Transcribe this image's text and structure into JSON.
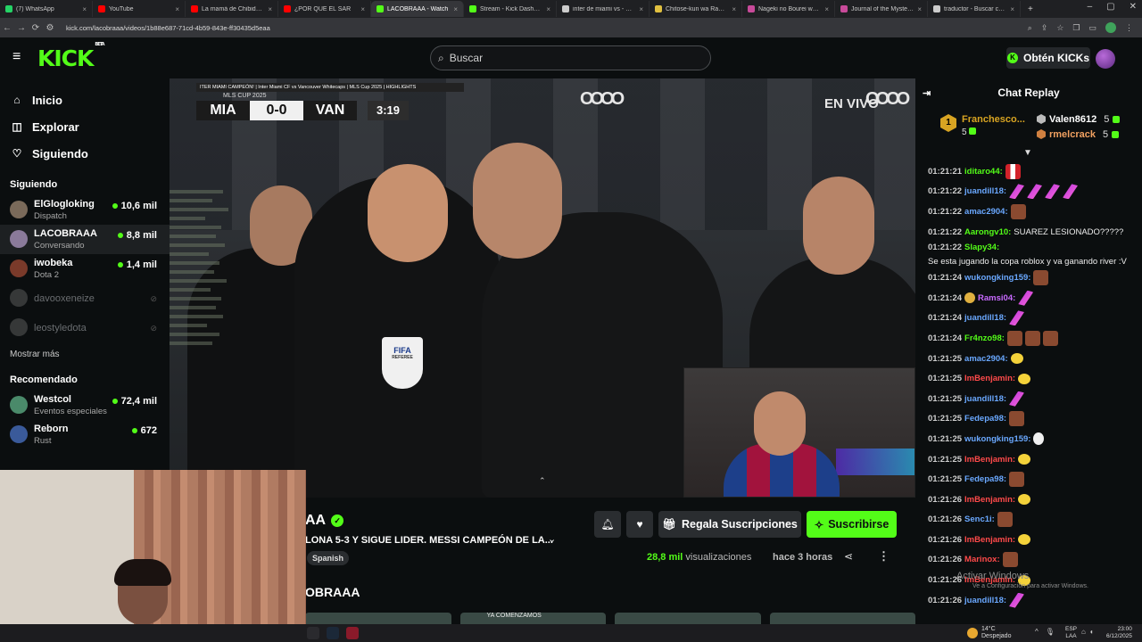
{
  "browser": {
    "tabs": [
      {
        "label": "(7) WhatsApp",
        "color": "#25d366",
        "active": false
      },
      {
        "label": "YouTube",
        "color": "#ff0000",
        "active": false
      },
      {
        "label": "La mamá de Chibidoki ap",
        "color": "#ff0000",
        "active": false
      },
      {
        "label": "¿POR QUÉ EL SAR",
        "color": "#ff0000",
        "active": false
      },
      {
        "label": "LACOBRAAA - Watch",
        "color": "#53fc18",
        "active": true
      },
      {
        "label": "Stream - Kick Dashboard",
        "color": "#53fc18",
        "active": false
      },
      {
        "label": "inter de miami vs - Busca",
        "color": "#cccccc",
        "active": false
      },
      {
        "label": "Chitose-kun wa Ramune",
        "color": "#e0c040",
        "active": false
      },
      {
        "label": "Nageki no Bourei wa In",
        "color": "#c84a9a",
        "active": false
      },
      {
        "label": "Journal of the Mysterio",
        "color": "#c84a9a",
        "active": false
      },
      {
        "label": "traductor - Buscar con G",
        "color": "#cccccc",
        "active": false
      }
    ],
    "url": "kick.com/lacobraaa/videos/1b88e687-71cd-4b59-843e-ff30435d5eaa"
  },
  "header": {
    "logo": "KICK",
    "logo_sup": "BETA",
    "search_placeholder": "Buscar",
    "kicks_button": "Obtén KICKs"
  },
  "sidebar": {
    "nav": [
      {
        "label": "Inicio",
        "icon": "home-icon"
      },
      {
        "label": "Explorar",
        "icon": "compass-icon"
      },
      {
        "label": "Siguiendo",
        "icon": "heart-icon"
      }
    ],
    "following_title": "Siguiendo",
    "following": [
      {
        "name": "ElGlogloking",
        "category": "Dispatch",
        "viewers": "10,6 mil",
        "color": "#7a6a5a"
      },
      {
        "name": "LACOBRAAA",
        "category": "Conversando",
        "viewers": "8,8 mil",
        "color": "#8a7a9a"
      },
      {
        "name": "iwobeka",
        "category": "Dota 2",
        "viewers": "1,4 mil",
        "color": "#7a3a2a"
      },
      {
        "name": "davooxeneize",
        "category": "",
        "viewers": "",
        "color": "#888888"
      },
      {
        "name": "leostyledota",
        "category": "",
        "viewers": "",
        "color": "#888888"
      }
    ],
    "show_more": "Mostrar más",
    "recommended_title": "Recomendado",
    "recommended": [
      {
        "name": "Westcol",
        "category": "Eventos especiales",
        "viewers": "72,4 mil",
        "color": "#4a8a6a"
      },
      {
        "name": "Reborn",
        "category": "Rust",
        "viewers": "672",
        "color": "#3a5a9a"
      }
    ]
  },
  "player": {
    "scorebug_top": "ITER MIAMI CAMPEÓN! | Inter Miami CF vs Vancouver Whitecaps | MLS Cup 2025 | HIGHLIGHTS",
    "scorebug_sub": "MLS CUP 2025",
    "home": "MIA",
    "score": "0-0",
    "away": "VAN",
    "clock": "3:19",
    "live": "EN VIVO",
    "audi": "OOOO",
    "fifa": "FIFA",
    "referee": "REFEREE"
  },
  "stream": {
    "channel": "AA",
    "title": "LONA 5-3 Y SIGUE LIDER. MESSI CAMPEÓN DE LA...",
    "language": "Spanish",
    "gift_button": "Regala Suscripciones",
    "subscribe_button": "Suscribirse",
    "views_count": "28,8 mil",
    "views_label": "visualizaciones",
    "since": "hace 3 horas",
    "section_title": "OBRAAA",
    "thumbs": [
      "",
      "YA COMENZAMOS",
      "",
      ""
    ]
  },
  "chat": {
    "title": "Chat Replay",
    "top_gifter": {
      "rank": "1",
      "name": "Franchesco...",
      "count": "5"
    },
    "gifters": [
      {
        "name": "Valen8612",
        "count": "5",
        "color": "#ffffff"
      },
      {
        "name": "rmelcrack",
        "count": "5",
        "color": "#f0a060"
      }
    ],
    "messages": [
      {
        "time": "01:21:21",
        "user": "iditaro44:",
        "color": "#53fc18",
        "text": "",
        "emotes": [
          "flag"
        ]
      },
      {
        "time": "01:21:22",
        "user": "juandill18:",
        "color": "#6aa8ff",
        "text": "",
        "emotes": [
          "purple",
          "purple",
          "purple",
          "purple"
        ]
      },
      {
        "time": "01:21:22",
        "user": "amac2904:",
        "color": "#6aa8ff",
        "text": "",
        "emotes": [
          "face"
        ]
      },
      {
        "time": "01:21:22",
        "user": "Aarongv10:",
        "color": "#53fc18",
        "text": "SUAREZ LESIONADO?????",
        "emotes": []
      },
      {
        "time": "01:21:22",
        "user": "Slapy34:",
        "color": "#53fc18",
        "text": "Se esta jugando la copa roblox y va ganando river :V",
        "emotes": []
      },
      {
        "time": "01:21:24",
        "user": "wukongking159:",
        "color": "#6aa8ff",
        "text": "",
        "emotes": [
          "face"
        ]
      },
      {
        "time": "01:21:24",
        "user": "Ramsi04:",
        "color": "#c86aff",
        "text": "",
        "emotes": [
          "purple"
        ],
        "badge": "gold"
      },
      {
        "time": "01:21:24",
        "user": "juandill18:",
        "color": "#6aa8ff",
        "text": "",
        "emotes": [
          "purple"
        ]
      },
      {
        "time": "01:21:24",
        "user": "Fr4nzo98:",
        "color": "#53fc18",
        "text": "",
        "emotes": [
          "face",
          "face",
          "face"
        ]
      },
      {
        "time": "01:21:25",
        "user": "amac2904:",
        "color": "#6aa8ff",
        "text": "",
        "emotes": [
          "yellow"
        ]
      },
      {
        "time": "01:21:25",
        "user": "ImBenjamin:",
        "color": "#ff4a4a",
        "text": "",
        "emotes": [
          "yellow"
        ]
      },
      {
        "time": "01:21:25",
        "user": "juandill18:",
        "color": "#6aa8ff",
        "text": "",
        "emotes": [
          "purple"
        ]
      },
      {
        "time": "01:21:25",
        "user": "Fedepa98:",
        "color": "#6aa8ff",
        "text": "",
        "emotes": [
          "face"
        ]
      },
      {
        "time": "01:21:25",
        "user": "wukongking159:",
        "color": "#6aa8ff",
        "text": "",
        "emotes": [
          "duck"
        ]
      },
      {
        "time": "01:21:25",
        "user": "ImBenjamin:",
        "color": "#ff4a4a",
        "text": "",
        "emotes": [
          "yellow"
        ]
      },
      {
        "time": "01:21:25",
        "user": "Fedepa98:",
        "color": "#6aa8ff",
        "text": "",
        "emotes": [
          "face"
        ]
      },
      {
        "time": "01:21:26",
        "user": "ImBenjamin:",
        "color": "#ff4a4a",
        "text": "",
        "emotes": [
          "yellow"
        ]
      },
      {
        "time": "01:21:26",
        "user": "Senc1i:",
        "color": "#6aa8ff",
        "text": "",
        "emotes": [
          "face"
        ]
      },
      {
        "time": "01:21:26",
        "user": "ImBenjamin:",
        "color": "#ff4a4a",
        "text": "",
        "emotes": [
          "yellow"
        ]
      },
      {
        "time": "01:21:26",
        "user": "Marinox:",
        "color": "#ff4a4a",
        "text": "",
        "emotes": [
          "face"
        ]
      },
      {
        "time": "01:21:26",
        "user": "ImBenjamin:",
        "color": "#ff4a4a",
        "text": "",
        "emotes": [
          "yellow"
        ]
      },
      {
        "time": "01:21:26",
        "user": "juandill18:",
        "color": "#6aa8ff",
        "text": "",
        "emotes": [
          "purple"
        ]
      }
    ],
    "watermark": "Activar Windows",
    "watermark_sub": "Ve a Configuración para activar Windows."
  },
  "taskbar": {
    "temp": "14°C",
    "weather": "Despejado",
    "lang_top": "ESP",
    "lang_bottom": "LAA",
    "time": "23:00",
    "date": "6/12/2025"
  },
  "colors": {
    "accent": "#53fc18",
    "background": "#0b0e0f"
  }
}
